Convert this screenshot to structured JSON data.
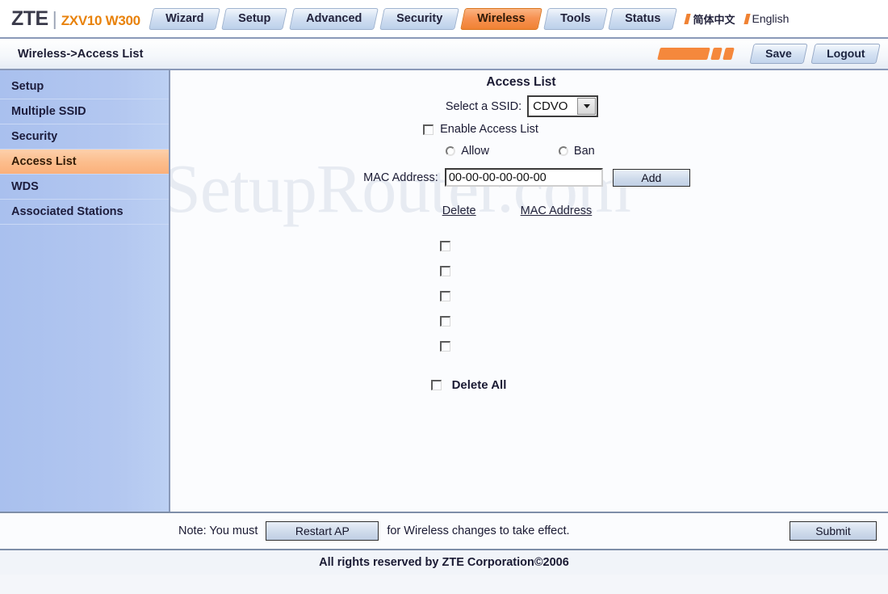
{
  "brand": {
    "name": "ZTE",
    "separator": "|",
    "model": "ZXV10 W300"
  },
  "nav": {
    "tabs": [
      {
        "label": "Wizard",
        "active": false
      },
      {
        "label": "Setup",
        "active": false
      },
      {
        "label": "Advanced",
        "active": false
      },
      {
        "label": "Security",
        "active": false
      },
      {
        "label": "Wireless",
        "active": true
      },
      {
        "label": "Tools",
        "active": false
      },
      {
        "label": "Status",
        "active": false
      }
    ],
    "languages": [
      {
        "label": "简体中文"
      },
      {
        "label": "English"
      }
    ]
  },
  "crumbbar": {
    "breadcrumb": "Wireless->Access List",
    "save_label": "Save",
    "logout_label": "Logout"
  },
  "sidebar": {
    "items": [
      {
        "label": "Setup",
        "active": false
      },
      {
        "label": "Multiple SSID",
        "active": false
      },
      {
        "label": "Security",
        "active": false
      },
      {
        "label": "Access List",
        "active": true
      },
      {
        "label": "WDS",
        "active": false
      },
      {
        "label": "Associated Stations",
        "active": false
      }
    ]
  },
  "watermark": {
    "text": "SetupRouter.com"
  },
  "main": {
    "title": "Access List",
    "ssid": {
      "label": "Select a SSID:",
      "selected": "CDVO",
      "options": [
        "CDVO"
      ]
    },
    "enable": {
      "label": "Enable Access List",
      "checked": false
    },
    "mode": {
      "allow_label": "Allow",
      "ban_label": "Ban",
      "selected": ""
    },
    "mac": {
      "label": "MAC Address:",
      "value": "00-00-00-00-00-00",
      "placeholder": "00-00-00-00-00-00",
      "add_label": "Add"
    },
    "table": {
      "columns": [
        "Delete",
        "MAC Address"
      ],
      "rows": [
        {
          "checked": false,
          "mac": ""
        },
        {
          "checked": false,
          "mac": ""
        },
        {
          "checked": false,
          "mac": ""
        },
        {
          "checked": false,
          "mac": ""
        },
        {
          "checked": false,
          "mac": ""
        }
      ]
    },
    "delete_all": {
      "label": "Delete All",
      "checked": false
    }
  },
  "footer": {
    "note_prefix": "Note: You must",
    "restart_label": "Restart AP",
    "note_suffix": "for Wireless changes to take effect.",
    "submit_label": "Submit",
    "copyright": "All rights reserved by ZTE Corporation©2006"
  },
  "colors": {
    "accent_orange": "#f08233",
    "sidebar_blue": "#b3c7f0",
    "tab_blue": "#d3e0f2",
    "highlight_peach": "#fcbe8e"
  }
}
